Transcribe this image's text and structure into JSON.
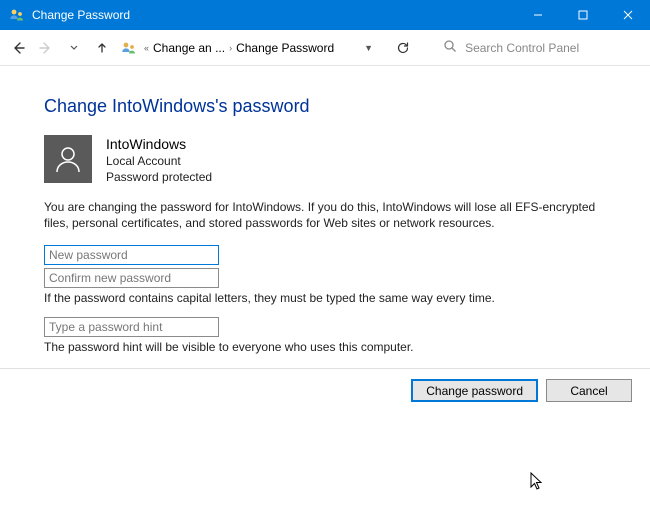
{
  "titlebar": {
    "title": "Change Password"
  },
  "breadcrumb": {
    "part1": "Change an ...",
    "part2": "Change Password"
  },
  "search": {
    "placeholder": "Search Control Panel"
  },
  "page": {
    "title": "Change IntoWindows's password"
  },
  "user": {
    "name": "IntoWindows",
    "type": "Local Account",
    "status": "Password protected"
  },
  "warning": "You are changing the password for IntoWindows.  If you do this, IntoWindows will lose all EFS-encrypted files, personal certificates, and stored passwords for Web sites or network resources.",
  "fields": {
    "new_password_placeholder": "New password",
    "confirm_password_placeholder": "Confirm new password",
    "caps_note": "If the password contains capital letters, they must be typed the same way every time.",
    "hint_placeholder": "Type a password hint",
    "hint_note": "The password hint will be visible to everyone who uses this computer."
  },
  "buttons": {
    "submit": "Change password",
    "cancel": "Cancel"
  }
}
